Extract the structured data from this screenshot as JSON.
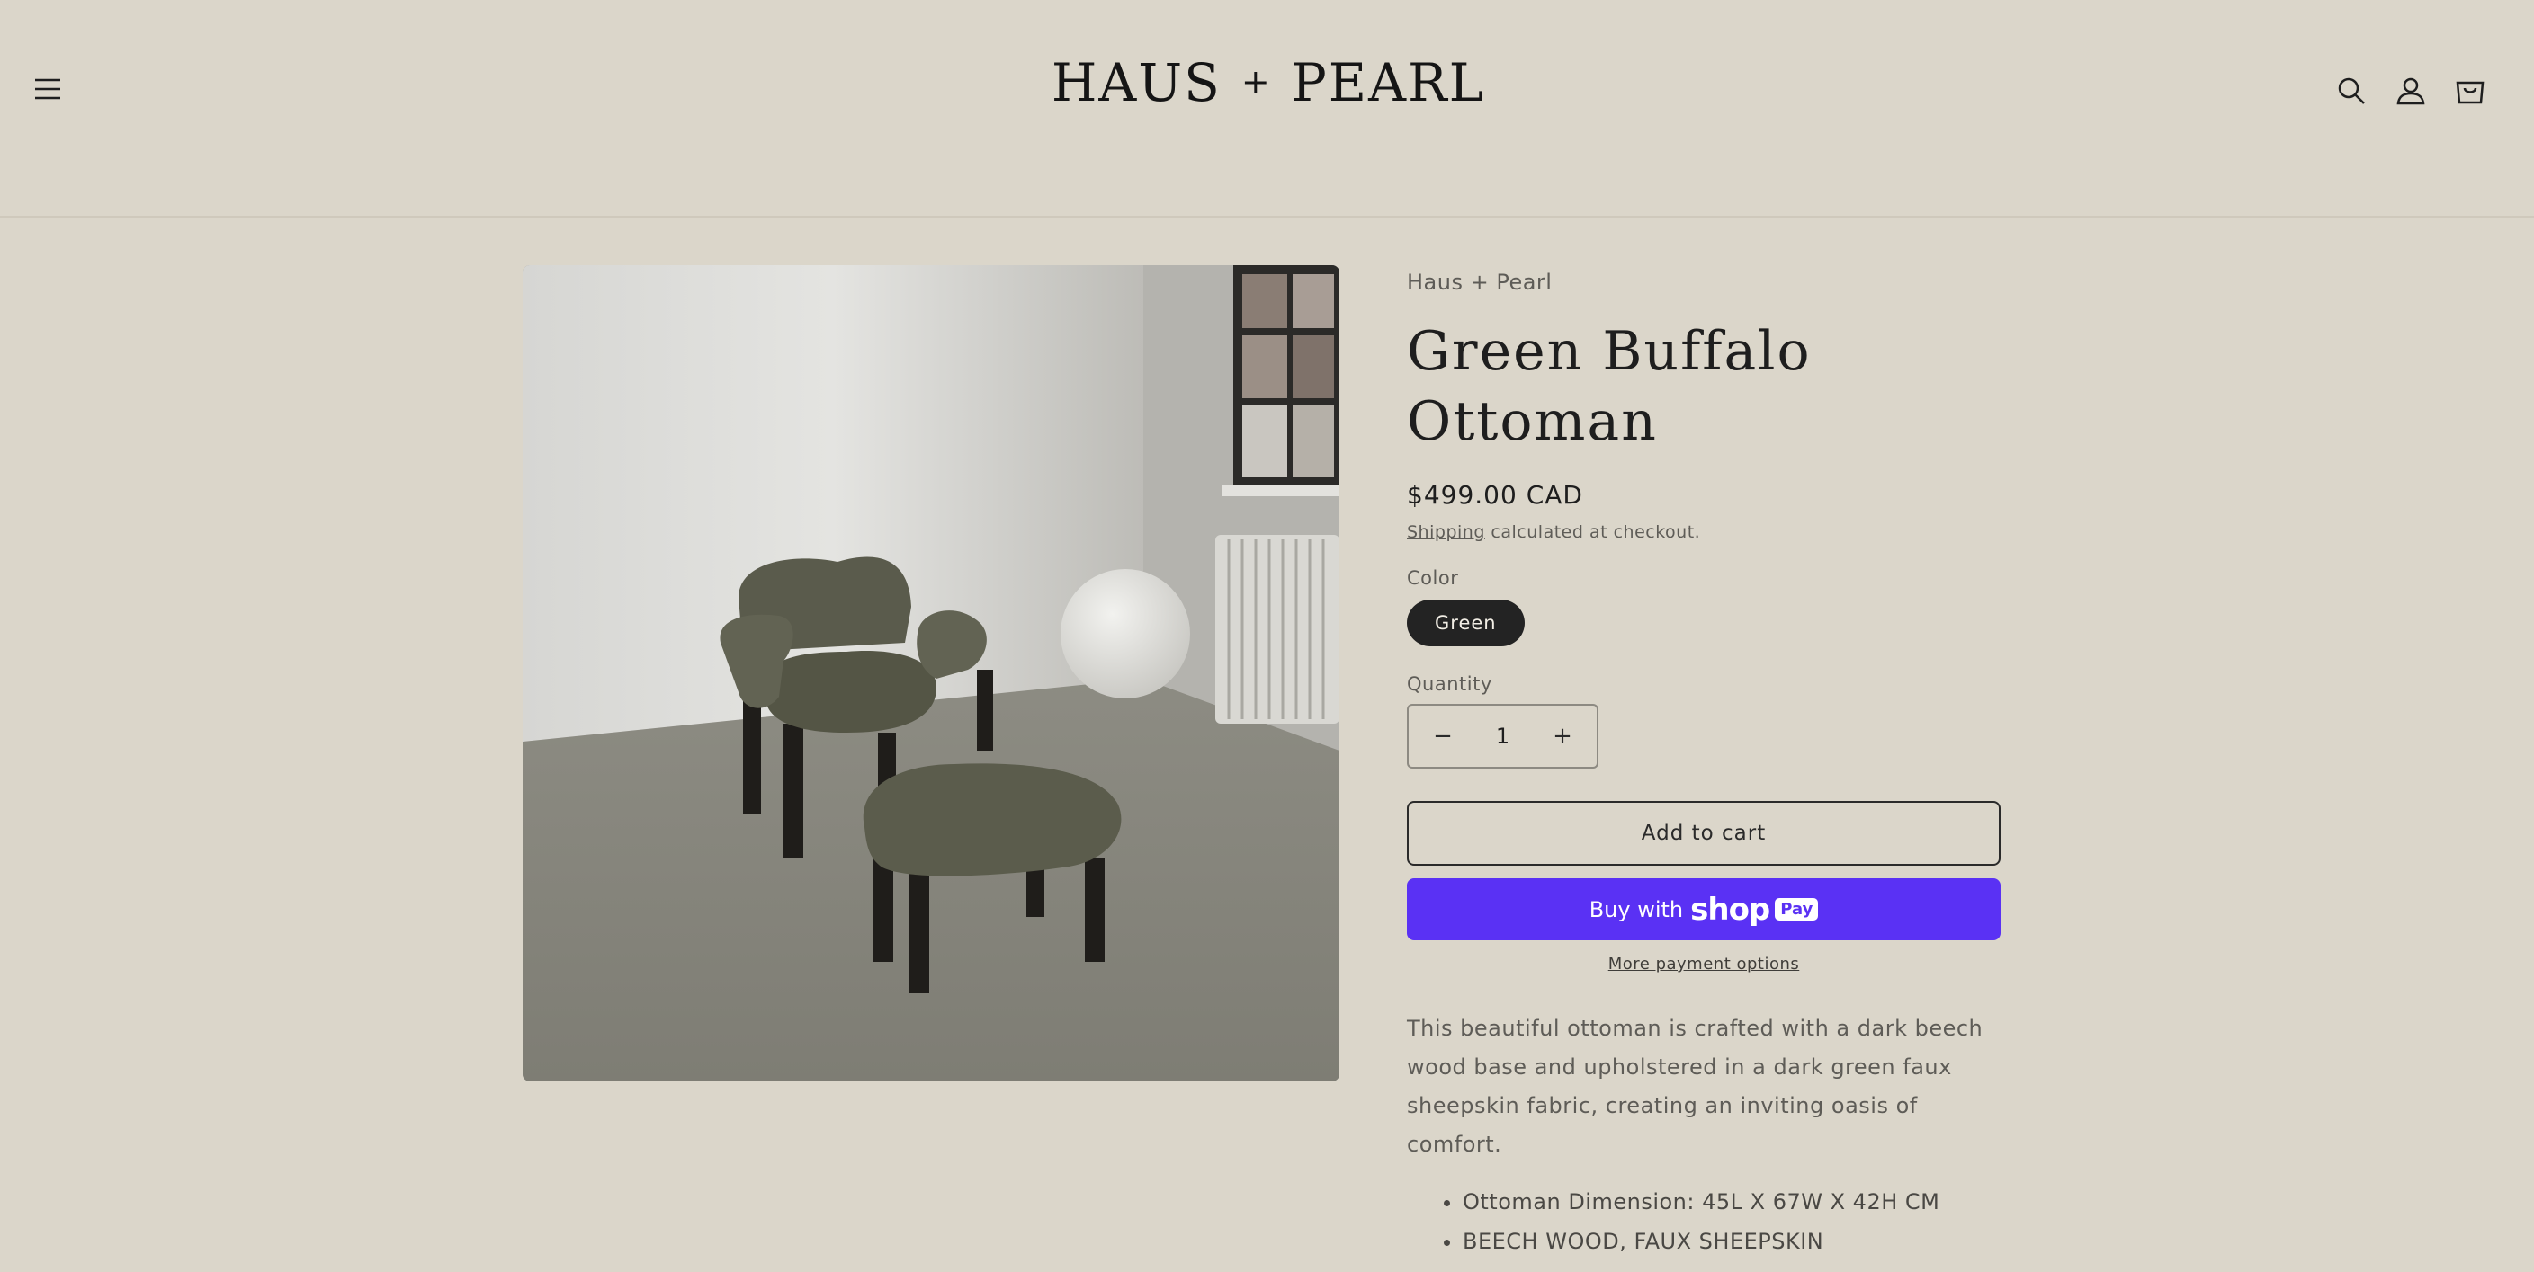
{
  "header": {
    "logo_left": "HAUS",
    "logo_plus": "+",
    "logo_right": "PEARL",
    "icons": [
      "menu-icon",
      "search-icon",
      "account-icon",
      "cart-icon"
    ]
  },
  "product": {
    "vendor": "Haus + Pearl",
    "title_line1": "Green Buffalo",
    "title_line2": "Ottoman",
    "price": "$499.00 CAD",
    "shipping_link": "Shipping",
    "shipping_rest": " calculated at checkout.",
    "color_label": "Color",
    "color_value": "Green",
    "quantity_label": "Quantity",
    "quantity_value": "1",
    "decrease_symbol": "−",
    "increase_symbol": "+",
    "add_to_cart": "Add to cart",
    "buy_with": "Buy with",
    "shop_word": "shop",
    "pay_word": "Pay",
    "more_payment": "More payment options",
    "description": "This beautiful ottoman is crafted with a dark beech wood base and upholstered in a dark green faux sheepskin fabric, creating an inviting oasis of comfort.",
    "bullets": [
      "Ottoman Dimension: 45L X 67W X 42H CM",
      "BEECH WOOD, FAUX SHEEPSKIN"
    ]
  },
  "colors": {
    "background": "#dbd6ca",
    "shop_pay": "#5a31f4",
    "swatch": "#232323"
  }
}
